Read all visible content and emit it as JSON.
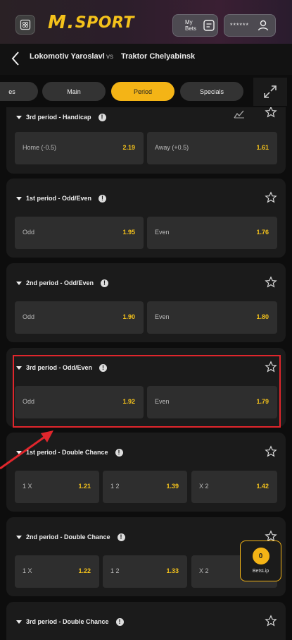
{
  "header": {
    "logo_m": "M",
    "logo_dot": ".",
    "logo_sport": "SPORT",
    "my_bets_label": "My Bets",
    "account_masked": "******"
  },
  "match": {
    "home": "Lokomotiv Yaroslavl",
    "vs": "vs",
    "away": "Traktor Chelyabinsk"
  },
  "tabs": [
    {
      "label": "es"
    },
    {
      "label": "Main"
    },
    {
      "label": "Period",
      "active": true
    },
    {
      "label": "Specials"
    }
  ],
  "markets": [
    {
      "title": "3rd period - Handicap",
      "has_chart": true,
      "odds": [
        {
          "label": "Home (-0.5)",
          "value": "2.19"
        },
        {
          "label": "Away (+0.5)",
          "value": "1.61"
        }
      ]
    },
    {
      "title": "1st period - Odd/Even",
      "odds": [
        {
          "label": "Odd",
          "value": "1.95"
        },
        {
          "label": "Even",
          "value": "1.76"
        }
      ]
    },
    {
      "title": "2nd period - Odd/Even",
      "odds": [
        {
          "label": "Odd",
          "value": "1.90"
        },
        {
          "label": "Even",
          "value": "1.80"
        }
      ]
    },
    {
      "title": "3rd period - Odd/Even",
      "highlighted": true,
      "odds": [
        {
          "label": "Odd",
          "value": "1.92"
        },
        {
          "label": "Even",
          "value": "1.79"
        }
      ]
    },
    {
      "title": "1st period - Double Chance",
      "odds": [
        {
          "label": "1 X",
          "value": "1.21"
        },
        {
          "label": "1 2",
          "value": "1.39"
        },
        {
          "label": "X 2",
          "value": "1.42"
        }
      ]
    },
    {
      "title": "2nd period - Double Chance",
      "odds": [
        {
          "label": "1 X",
          "value": "1.22"
        },
        {
          "label": "1 2",
          "value": "1.33"
        },
        {
          "label": "X 2",
          "value": ""
        }
      ]
    },
    {
      "title": "3rd period - Double Chance",
      "odds": []
    }
  ],
  "betslip": {
    "count": "0",
    "label": "BetsLip"
  },
  "colors": {
    "accent": "#f4b416",
    "odds_value": "#f4c21b",
    "highlight": "#e0262c"
  }
}
